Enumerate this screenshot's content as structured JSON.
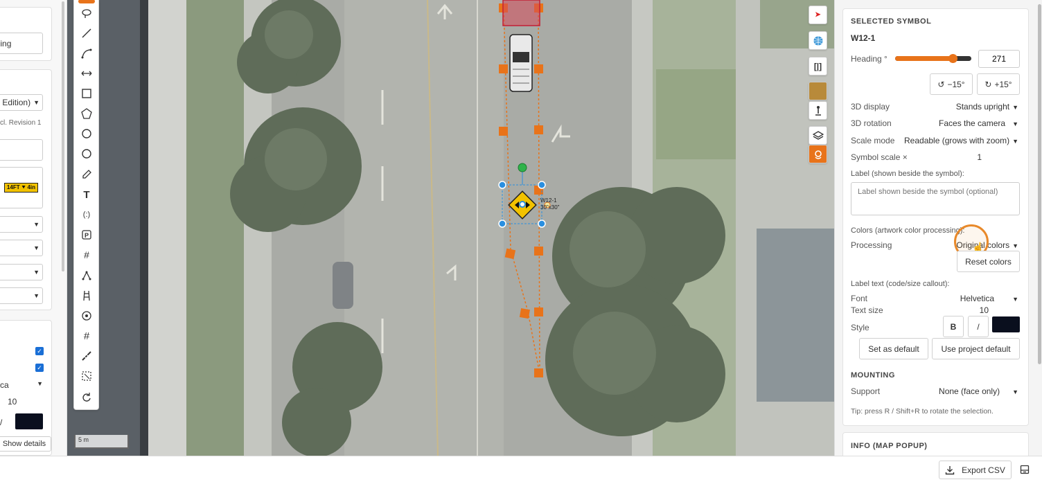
{
  "left_panel": {
    "planning_label": "nning",
    "edition_label": "Edition)",
    "revision_note": "cl. Revision 1",
    "sign_preview_text": "14FT ⯆ 4in",
    "font_value": "ca",
    "size_value": "10",
    "style_italic": "/",
    "show_details": "Show details"
  },
  "map": {
    "sign_label_line1": "W12-1",
    "sign_label_line2": "30\"x30\"",
    "scale_label": "5 m"
  },
  "toolbar": {
    "tools": [
      "lasso-tool",
      "line-tool",
      "curve-tool",
      "dimension-tool",
      "rectangle-tool",
      "polygon-tool",
      "circle-tool",
      "ellipse-tool",
      "pencil-tool",
      "text-tool",
      "callout-tool",
      "parking-tool",
      "crosswalk-tool",
      "node-tool",
      "ladder-tool",
      "target-tool",
      "hatch-tool",
      "measure-tool",
      "select-area-tool",
      "rotate-tool"
    ]
  },
  "selected_symbol": {
    "section_title": "SELECTED SYMBOL",
    "code": "W12-1",
    "heading_label": "Heading °",
    "heading_value": "271",
    "heading_fraction": 0.75,
    "rotate_ccw": "−15°",
    "rotate_cw": "+15°",
    "display_3d_label": "3D display",
    "display_3d_value": "Stands upright",
    "rotation_3d_label": "3D rotation",
    "rotation_3d_value": "Faces the camera",
    "scale_mode_label": "Scale mode",
    "scale_mode_value": "Readable (grows with zoom)",
    "symbol_scale_label": "Symbol scale ×",
    "symbol_scale_value": "1",
    "label_field_label": "Label (shown beside the symbol):",
    "label_placeholder": "Label shown beside the symbol (optional)",
    "colors_label": "Colors (artwork color processing):",
    "processing_label": "Processing",
    "processing_value": "Original colors",
    "reset_colors": "Reset colors",
    "label_text_header": "Label text (code/size callout):",
    "font_label": "Font",
    "font_value": "Helvetica",
    "text_size_label": "Text size",
    "text_size_value": "10",
    "style_label": "Style",
    "bold": "B",
    "italic": "/",
    "text_color": "#0a0f1e",
    "set_default": "Set as default",
    "use_project_default": "Use project default",
    "mounting_title": "MOUNTING",
    "support_label": "Support",
    "support_value": "None (face only)",
    "tip": "Tip: press R / Shift+R to rotate the selection."
  },
  "info": {
    "title": "INFO (MAP POPUP)"
  },
  "bottom": {
    "export_csv": "Export CSV"
  },
  "colors": {
    "accent": "#e8731a",
    "selection": "#2a8fe0"
  }
}
